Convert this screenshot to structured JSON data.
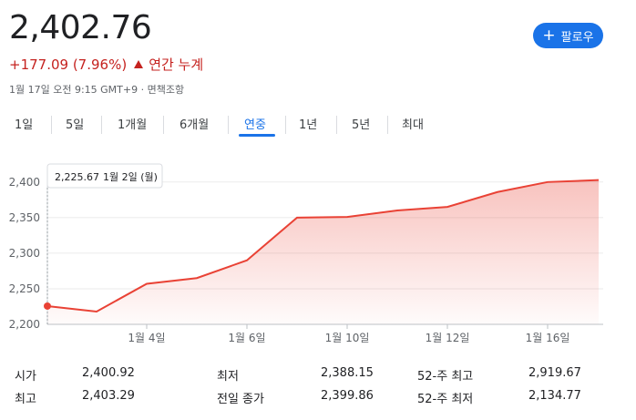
{
  "quote": {
    "price": "2,402.76",
    "change": "+177.09 (7.96%)",
    "period_label": "연간 누계",
    "timestamp": "1월 17일 오전 9:15 GMT+9 · 면책조항",
    "follow_label": "팔로우",
    "accent_color": "#1a73e8",
    "change_color": "#c5221f"
  },
  "tabs": [
    {
      "label": "1일"
    },
    {
      "label": "5일"
    },
    {
      "label": "1개월"
    },
    {
      "label": "6개월"
    },
    {
      "label": "연중",
      "active": true
    },
    {
      "label": "1년"
    },
    {
      "label": "5년"
    },
    {
      "label": "최대"
    }
  ],
  "tooltip": {
    "value": "2,225.67",
    "date": "1월 2일 (월)"
  },
  "chart_data": {
    "type": "area",
    "x": [
      "1월 2일",
      "1월 3일",
      "1월 4일",
      "1월 5일",
      "1월 6일",
      "1월 9일",
      "1월 10일",
      "1월 11일",
      "1월 12일",
      "1월 13일",
      "1월 16일",
      "1월 17일"
    ],
    "values": [
      2225.67,
      2218,
      2257,
      2265,
      2290,
      2350,
      2351,
      2360,
      2365,
      2386,
      2400,
      2402.76
    ],
    "y_ticks": [
      "2,400",
      "2,350",
      "2,300",
      "2,250",
      "2,200"
    ],
    "x_ticks": [
      "1월 4일",
      "1월 6일",
      "1월 10일",
      "1월 12일",
      "1월 16일"
    ],
    "ylim": [
      2200,
      2410
    ],
    "line_color": "#e94235",
    "grid": true
  },
  "stats": [
    {
      "label": "시가",
      "value": "2,400.92"
    },
    {
      "label": "최고",
      "value": "2,403.29"
    },
    {
      "label": "최저",
      "value": "2,388.15"
    },
    {
      "label": "전일 종가",
      "value": "2,399.86"
    },
    {
      "label": "52-주 최고",
      "value": "2,919.67"
    },
    {
      "label": "52-주 최저",
      "value": "2,134.77"
    }
  ]
}
